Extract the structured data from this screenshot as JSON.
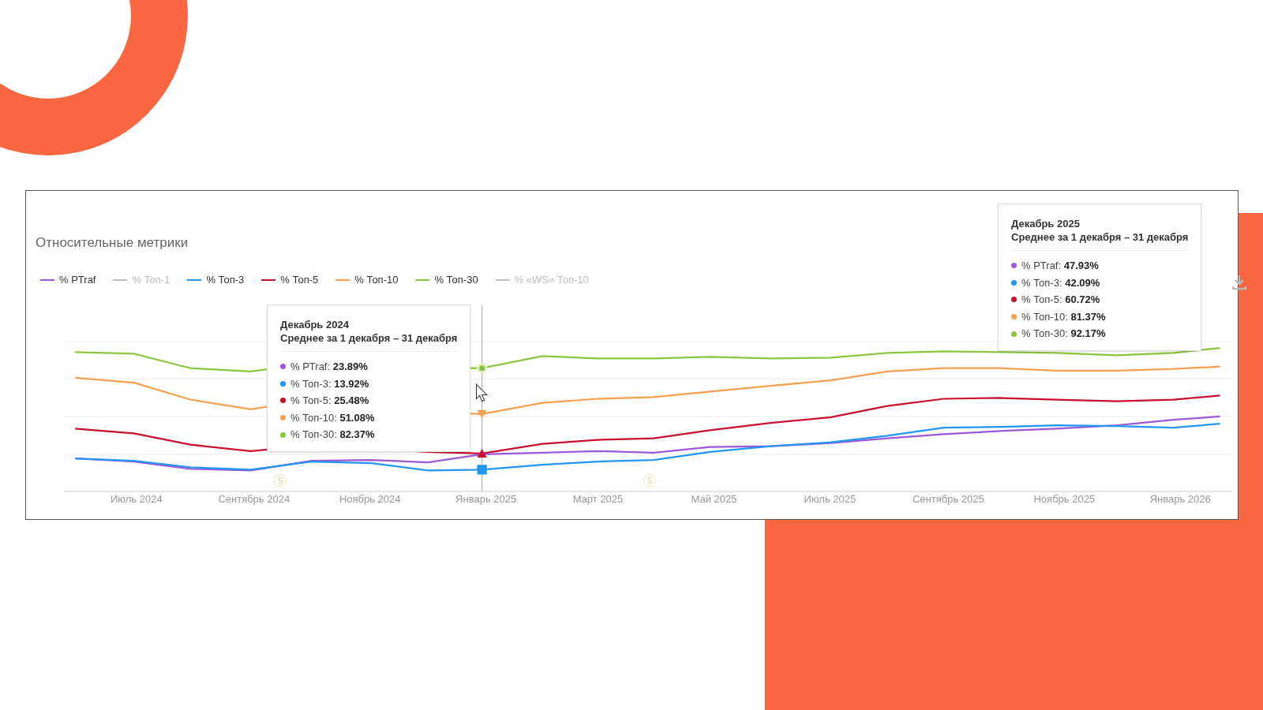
{
  "card": {
    "title": "Относительные метрики"
  },
  "legend": [
    {
      "label": "% PTraf",
      "color": "#9b59d6",
      "disabled": false
    },
    {
      "label": "% Топ-1",
      "color": "#bdbdbd",
      "disabled": true
    },
    {
      "label": "% Топ-3",
      "color": "#2196f3",
      "disabled": false
    },
    {
      "label": "% Топ-5",
      "color": "#c8102e",
      "disabled": false
    },
    {
      "label": "% Топ-10",
      "color": "#f5a04f",
      "disabled": false
    },
    {
      "label": "% Топ-30",
      "color": "#8cc63f",
      "disabled": false
    },
    {
      "label": "% «WS» Топ-10",
      "color": "#bdbdbd",
      "disabled": true
    }
  ],
  "x_labels": [
    "Июль 2024",
    "Сентябрь 2024",
    "Ноябрь 2024",
    "Январь 2025",
    "Март 2025",
    "Май 2025",
    "Июль 2025",
    "Сентябрь 2025",
    "Ноябрь 2025",
    "Январь 2026"
  ],
  "event_markers": [
    {
      "label": "S"
    },
    {
      "label": "S"
    }
  ],
  "tooltips": [
    {
      "title": "Декабрь 2024",
      "subtitle": "Среднее за 1 декабря – 31 декабря",
      "rows": [
        {
          "label": "% PTraf:",
          "value": "23.89%",
          "color": "#9b59d6"
        },
        {
          "label": "% Топ-3:",
          "value": "13.92%",
          "color": "#2196f3"
        },
        {
          "label": "% Топ-5:",
          "value": "25.48%",
          "color": "#c8102e"
        },
        {
          "label": "% Топ-10:",
          "value": "51.08%",
          "color": "#f5a04f"
        },
        {
          "label": "% Топ-30:",
          "value": "82.37%",
          "color": "#8cc63f"
        }
      ]
    },
    {
      "title": "Декабрь 2025",
      "subtitle": "Среднее за 1 декабря – 31 декабря",
      "rows": [
        {
          "label": "% PTraf:",
          "value": "47.93%",
          "color": "#9b59d6"
        },
        {
          "label": "% Топ-3:",
          "value": "42.09%",
          "color": "#2196f3"
        },
        {
          "label": "% Топ-5:",
          "value": "60.72%",
          "color": "#c8102e"
        },
        {
          "label": "% Топ-10:",
          "value": "81.37%",
          "color": "#f5a04f"
        },
        {
          "label": "% Топ-30:",
          "value": "92.17%",
          "color": "#8cc63f"
        }
      ]
    }
  ]
}
